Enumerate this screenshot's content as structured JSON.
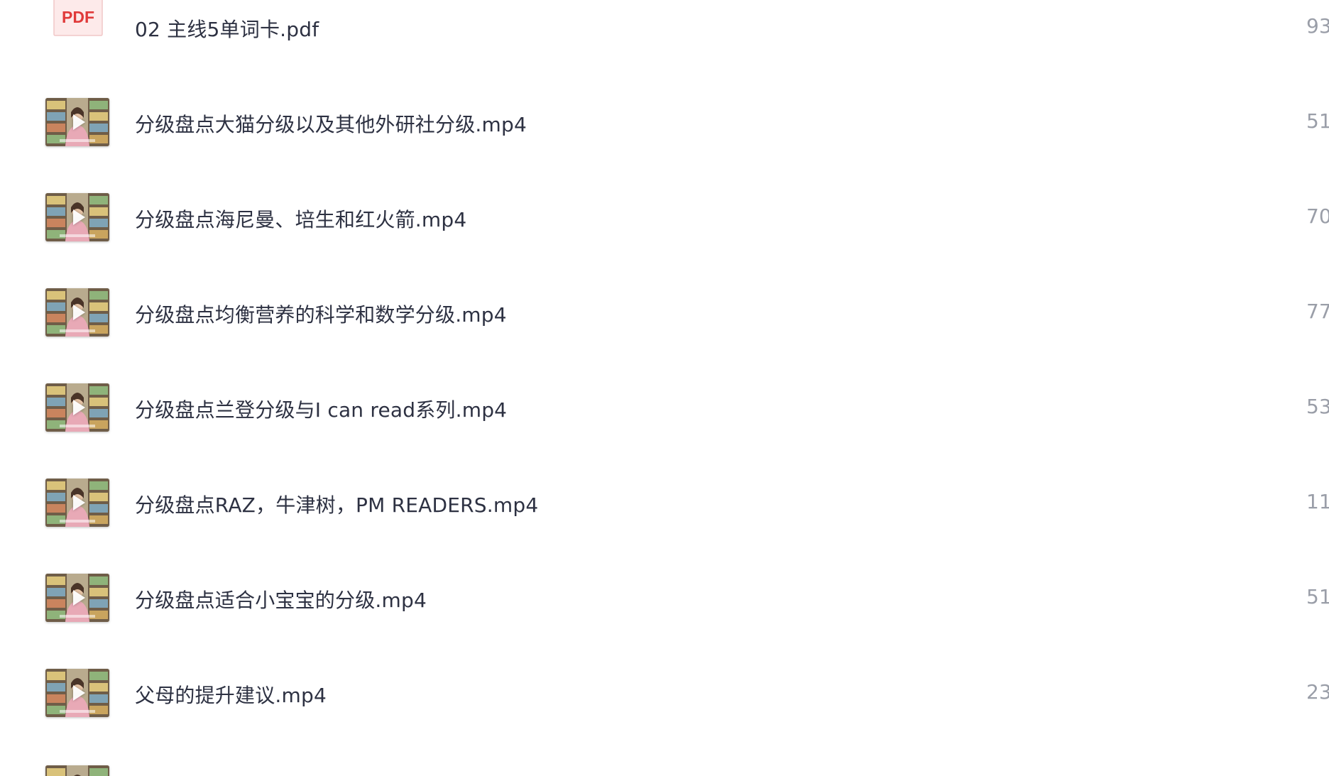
{
  "files": [
    {
      "name": "02 主线5单词卡.pdf",
      "size": "93",
      "type": "pdf",
      "icon": "pdf-file-icon",
      "icon_label": "PDF"
    },
    {
      "name": "分级盘点大猫分级以及其他外研社分级.mp4",
      "size": "51",
      "type": "video",
      "icon": "video-thumbnail"
    },
    {
      "name": "分级盘点海尼曼、培生和红火箭.mp4",
      "size": "70",
      "type": "video",
      "icon": "video-thumbnail"
    },
    {
      "name": "分级盘点均衡营养的科学和数学分级.mp4",
      "size": "77",
      "type": "video",
      "icon": "video-thumbnail"
    },
    {
      "name": "分级盘点兰登分级与I can read系列.mp4",
      "size": "53",
      "type": "video",
      "icon": "video-thumbnail"
    },
    {
      "name": "分级盘点RAZ，牛津树，PM READERS.mp4",
      "size": "11",
      "type": "video",
      "icon": "video-thumbnail"
    },
    {
      "name": "分级盘点适合小宝宝的分级.mp4",
      "size": "51",
      "type": "video",
      "icon": "video-thumbnail"
    },
    {
      "name": "父母的提升建议.mp4",
      "size": "23",
      "type": "video",
      "icon": "video-thumbnail"
    }
  ],
  "colors": {
    "text": "#2d3142",
    "size_text": "#9a9ea8",
    "pdf_red": "#e03a3a",
    "background": "#ffffff"
  }
}
